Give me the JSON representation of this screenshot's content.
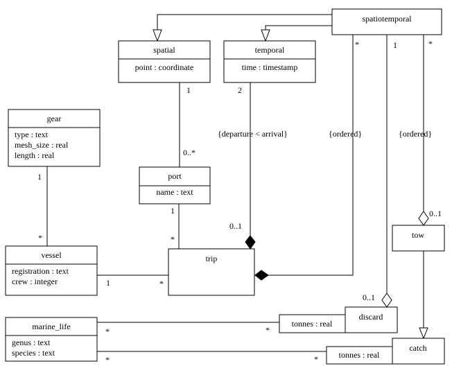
{
  "classes": {
    "spatiotemporal": {
      "name": "spatiotemporal",
      "attributes": []
    },
    "spatial": {
      "name": "spatial",
      "attributes": [
        "point : coordinate"
      ]
    },
    "temporal": {
      "name": "temporal",
      "attributes": [
        "time : timestamp"
      ]
    },
    "gear": {
      "name": "gear",
      "attributes": [
        "type : text",
        "mesh_size : real",
        "length : real"
      ]
    },
    "port": {
      "name": "port",
      "attributes": [
        "name : text"
      ]
    },
    "vessel": {
      "name": "vessel",
      "attributes": [
        "registration : text",
        "crew : integer"
      ]
    },
    "trip": {
      "name": "trip",
      "attributes": []
    },
    "tow": {
      "name": "tow",
      "attributes": []
    },
    "discard": {
      "name": "discard",
      "attributes": []
    },
    "catch": {
      "name": "catch",
      "attributes": []
    },
    "marine_life": {
      "name": "marine_life",
      "attributes": [
        "genus : text",
        "species : text"
      ]
    },
    "discard_assoc": {
      "name": "tonnes : real"
    },
    "catch_assoc": {
      "name": "tonnes : real"
    }
  },
  "relations": {
    "st_spatial": {
      "type": "generalization",
      "from": "spatiotemporal",
      "to": "spatial"
    },
    "st_temporal": {
      "type": "generalization",
      "from": "spatiotemporal",
      "to": "temporal"
    },
    "spatial_port": {
      "type": "association",
      "from_mult": "1",
      "to_mult": "0..*"
    },
    "temporal_trip": {
      "type": "composition",
      "from_mult": "2",
      "to_mult": "0..1",
      "constraint": "{departure < arrival}"
    },
    "st_trip": {
      "type": "composition",
      "from_mult": "*",
      "constraint": "{ordered}"
    },
    "st_discard": {
      "type": "aggregation",
      "from_mult": "1",
      "to_mult": "0..1"
    },
    "st_tow": {
      "type": "aggregation",
      "from_mult": "*",
      "to_mult": "0..1",
      "constraint": "{ordered}"
    },
    "gear_vessel": {
      "type": "association",
      "from_mult": "1",
      "to_mult": "*"
    },
    "port_trip": {
      "type": "association",
      "from_mult": "1",
      "to_mult": "*"
    },
    "vessel_trip": {
      "type": "association",
      "from_mult": "1",
      "to_mult": "*"
    },
    "tow_catch": {
      "type": "generalization"
    },
    "marine_discard": {
      "type": "association",
      "from_mult": "*",
      "to_mult": "*"
    },
    "marine_catch": {
      "type": "association",
      "from_mult": "*",
      "to_mult": "*"
    }
  }
}
